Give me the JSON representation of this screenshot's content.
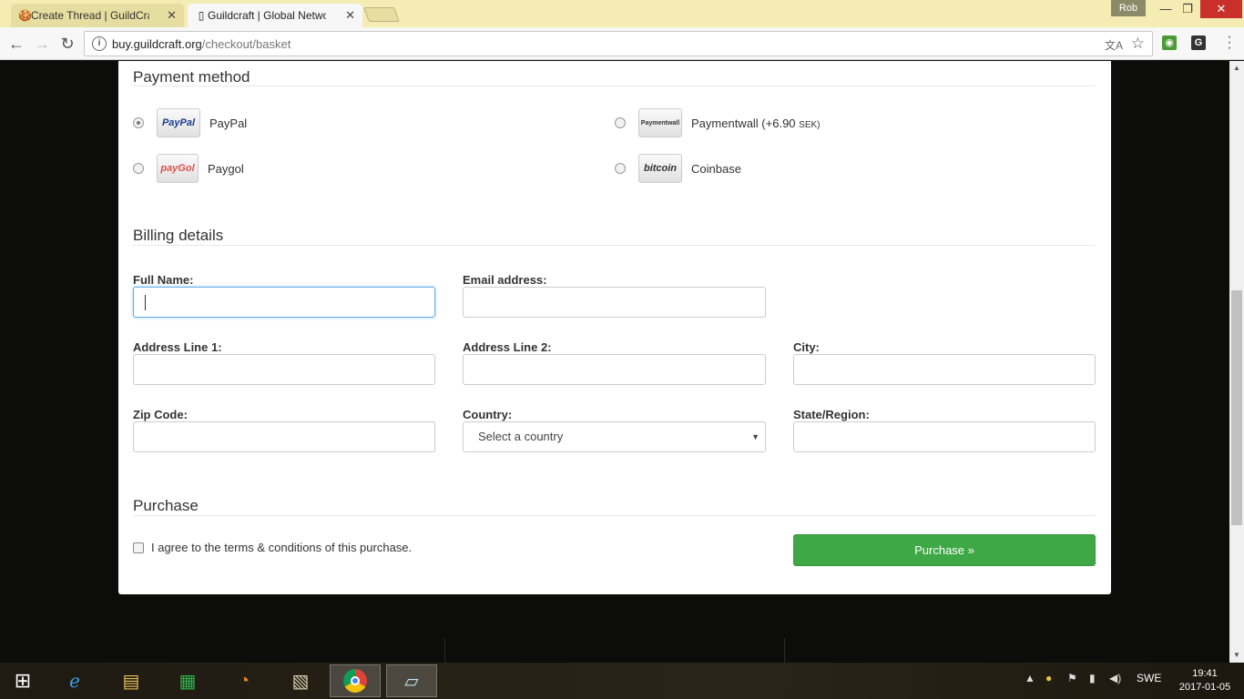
{
  "browser": {
    "tabs": [
      {
        "title": "Create Thread | GuildCraft",
        "close": "✕"
      },
      {
        "title": "Guildcraft | Global Network",
        "close": "✕"
      }
    ],
    "profile": "Rob",
    "window": {
      "minimize": "—",
      "maximize": "❐",
      "close": "✕"
    },
    "url_domain": "buy.guildcraft.org",
    "url_path": "/checkout/basket"
  },
  "payment": {
    "title": "Payment method",
    "methods": [
      {
        "logo": "PayPal",
        "label": "PayPal",
        "selected": true
      },
      {
        "logo": "Paymentwall",
        "label": "Paymentwall (+6.90 ",
        "suffix": "SEK)",
        "selected": false
      },
      {
        "logo": "payGol",
        "label": "Paygol",
        "selected": false
      },
      {
        "logo": "bitcoin",
        "label": "Coinbase",
        "selected": false
      }
    ]
  },
  "billing": {
    "title": "Billing details",
    "full_name_label": "Full Name:",
    "email_label": "Email address:",
    "address1_label": "Address Line 1:",
    "address2_label": "Address Line 2:",
    "city_label": "City:",
    "zip_label": "Zip Code:",
    "country_label": "Country:",
    "country_value": "Select a country",
    "state_label": "State/Region:"
  },
  "purchase": {
    "title": "Purchase",
    "agree_text": "I agree to the terms & conditions of this purchase.",
    "button_label": "Purchase »"
  },
  "taskbar": {
    "language": "SWE",
    "time": "19:41",
    "date": "2017-01-05"
  }
}
